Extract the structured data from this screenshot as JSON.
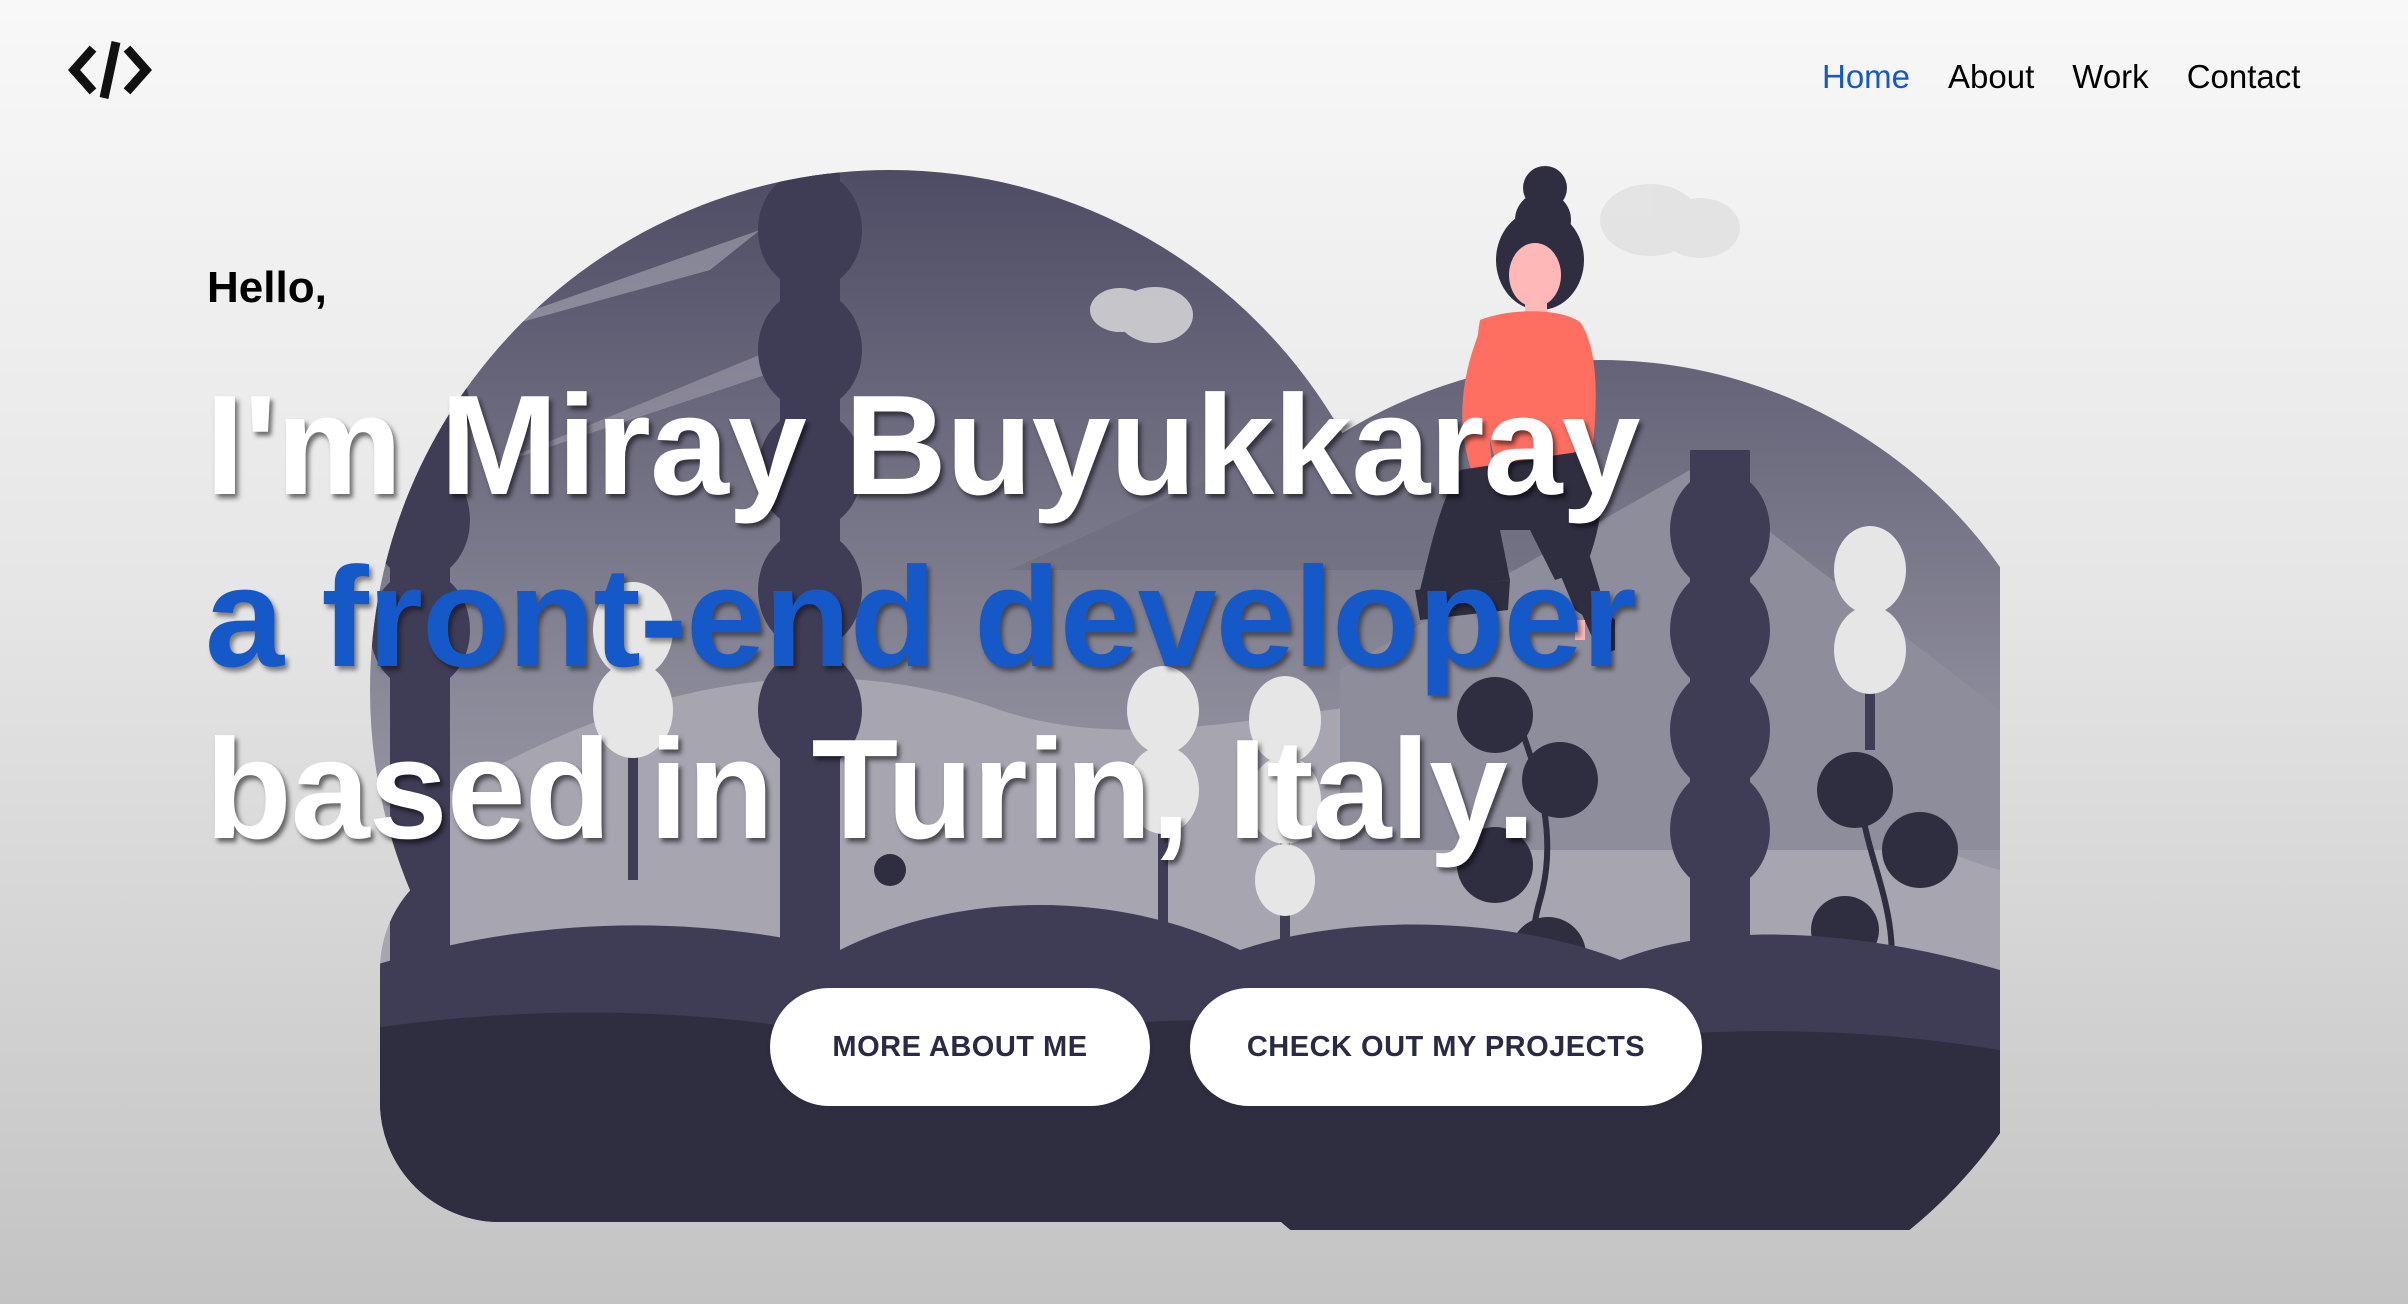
{
  "logo": {
    "icon": "code-brackets-icon"
  },
  "nav": {
    "items": [
      {
        "label": "Home",
        "active": true
      },
      {
        "label": "About",
        "active": false
      },
      {
        "label": "Work",
        "active": false
      },
      {
        "label": "Contact",
        "active": false
      }
    ]
  },
  "hero": {
    "greeting": "Hello,",
    "line1": "I'm Miray Buyukkaray",
    "line2": "a front-end developer",
    "line3": "based in Turin, Italy."
  },
  "buttons": {
    "about_label": "MORE ABOUT ME",
    "projects_label": "CHECK OUT MY PROJECTS"
  },
  "colors": {
    "accent": "#1558c8",
    "illustration_dark": "#3f3d56",
    "shirt": "#ff6f61"
  }
}
